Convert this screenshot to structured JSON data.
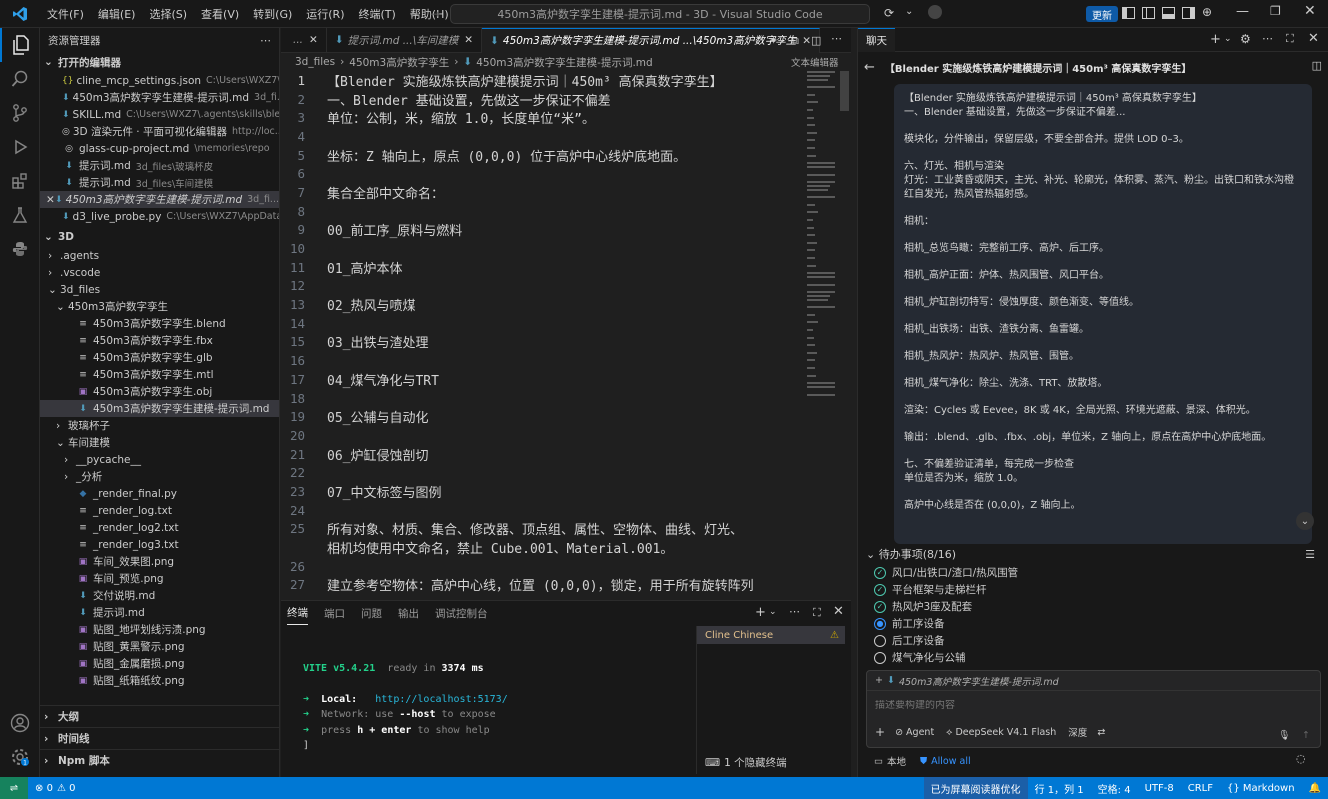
{
  "titlebar": {
    "menus": [
      "文件(F)",
      "编辑(E)",
      "选择(S)",
      "查看(V)",
      "转到(G)",
      "运行(R)",
      "终端(T)",
      "帮助(H)"
    ],
    "command_center": "450m3高炉数字孪生建模-提示词.md - 3D - Visual Studio Code",
    "update_label": "更新"
  },
  "explorer": {
    "title": "资源管理器",
    "open_editors_label": "打开的编辑器",
    "open_editors": [
      {
        "icon": "{}",
        "name": "cline_mcp_settings.json",
        "desc": "C:\\Users\\WXZ7\\.cli..."
      },
      {
        "icon": "⬇",
        "name": "450m3高炉数字孪生建模-提示词.md",
        "desc": "3d_fi..."
      },
      {
        "icon": "⬇",
        "name": "SKILL.md",
        "desc": "C:\\Users\\WXZ7\\.agents\\skills\\blend..."
      },
      {
        "icon": "◎",
        "name": "3D 渲染元件 · 平面可视化编辑器",
        "desc": "http://loc..."
      },
      {
        "icon": "◎",
        "name": "glass-cup-project.md",
        "desc": "\\memories\\repo"
      },
      {
        "icon": "⬇",
        "name": "提示词.md",
        "desc": "3d_files\\玻璃杯皮"
      },
      {
        "icon": "⬇",
        "name": "提示词.md",
        "desc": "3d_files\\车间建模"
      },
      {
        "icon": "⬇",
        "name": "450m3高炉数字孪生建模-提示词.md",
        "desc": "3d_fi..."
      },
      {
        "icon": "⬇",
        "name": "d3_live_probe.py",
        "desc": "C:\\Users\\WXZ7\\AppData\\L..."
      }
    ],
    "folder_label": "3D",
    "tree": [
      {
        "indent": 1,
        "chev": "›",
        "icon": "",
        "name": ".agents"
      },
      {
        "indent": 1,
        "chev": "›",
        "icon": "",
        "name": ".vscode"
      },
      {
        "indent": 1,
        "chev": "⌄",
        "icon": "",
        "name": "3d_files"
      },
      {
        "indent": 2,
        "chev": "⌄",
        "icon": "",
        "name": "450m3高炉数字孪生"
      },
      {
        "indent": 3,
        "chev": "",
        "icon": "≡",
        "name": "450m3高炉数字孪生.blend"
      },
      {
        "indent": 3,
        "chev": "",
        "icon": "≡",
        "name": "450m3高炉数字孪生.fbx"
      },
      {
        "indent": 3,
        "chev": "",
        "icon": "≡",
        "name": "450m3高炉数字孪生.glb"
      },
      {
        "indent": 3,
        "chev": "",
        "icon": "≡",
        "name": "450m3高炉数字孪生.mtl"
      },
      {
        "indent": 3,
        "chev": "",
        "icon": "▣",
        "name": "450m3高炉数字孪生.obj"
      },
      {
        "indent": 3,
        "chev": "",
        "icon": "⬇",
        "name": "450m3高炉数字孪生建模-提示词.md"
      },
      {
        "indent": 2,
        "chev": "›",
        "icon": "",
        "name": "玻璃杯子"
      },
      {
        "indent": 2,
        "chev": "⌄",
        "icon": "",
        "name": "车间建模"
      },
      {
        "indent": 3,
        "chev": "›",
        "icon": "",
        "name": "__pycache__"
      },
      {
        "indent": 3,
        "chev": "›",
        "icon": "",
        "name": "_分析"
      },
      {
        "indent": 3,
        "chev": "",
        "icon": "◆",
        "name": "_render_final.py"
      },
      {
        "indent": 3,
        "chev": "",
        "icon": "≡",
        "name": "_render_log.txt"
      },
      {
        "indent": 3,
        "chev": "",
        "icon": "≡",
        "name": "_render_log2.txt"
      },
      {
        "indent": 3,
        "chev": "",
        "icon": "≡",
        "name": "_render_log3.txt"
      },
      {
        "indent": 3,
        "chev": "",
        "icon": "▣",
        "name": "车间_效果图.png"
      },
      {
        "indent": 3,
        "chev": "",
        "icon": "▣",
        "name": "车间_预览.png"
      },
      {
        "indent": 3,
        "chev": "",
        "icon": "⬇",
        "name": "交付说明.md"
      },
      {
        "indent": 3,
        "chev": "",
        "icon": "⬇",
        "name": "提示词.md"
      },
      {
        "indent": 3,
        "chev": "",
        "icon": "▣",
        "name": "贴图_地坪划线污渍.png"
      },
      {
        "indent": 3,
        "chev": "",
        "icon": "▣",
        "name": "贴图_黄黑警示.png"
      },
      {
        "indent": 3,
        "chev": "",
        "icon": "▣",
        "name": "贴图_金属磨损.png"
      },
      {
        "indent": 3,
        "chev": "",
        "icon": "▣",
        "name": "贴图_纸箱纸纹.png"
      }
    ],
    "bottom_sections": [
      "大纲",
      "时间线",
      "Npm 脚本"
    ]
  },
  "editor": {
    "tabs": [
      {
        "label": "...",
        "close": false
      },
      {
        "label": "提示词.md ...\\车间建模",
        "close": true
      },
      {
        "label": "450m3高炉数字孪生建模-提示词.md ...\\450m3高炉数字孪生",
        "close": true,
        "active": true
      }
    ],
    "breadcrumb": [
      "3d_files",
      "450m3高炉数字孪生",
      "450m3高炉数字孪生建模-提示词.md"
    ],
    "text_editor_label": "文本编辑器",
    "lines": [
      {
        "n": "1",
        "t": "【Blender 实施级炼铁高炉建模提示词｜450m³ 高保真数字孪生】"
      },
      {
        "n": "2",
        "t": "一、Blender 基础设置，先做这一步保证不偏差"
      },
      {
        "n": "3",
        "t": "单位：公制，米，缩放 1.0，长度单位“米”。"
      },
      {
        "n": "4",
        "t": ""
      },
      {
        "n": "5",
        "t": "坐标：Z 轴向上，原点 (0,0,0) 位于高炉中心线炉底地面。"
      },
      {
        "n": "6",
        "t": ""
      },
      {
        "n": "7",
        "t": "集合全部中文命名："
      },
      {
        "n": "8",
        "t": ""
      },
      {
        "n": "9",
        "t": "00_前工序_原料与燃料"
      },
      {
        "n": "10",
        "t": ""
      },
      {
        "n": "11",
        "t": "01_高炉本体"
      },
      {
        "n": "12",
        "t": ""
      },
      {
        "n": "13",
        "t": "02_热风与喷煤"
      },
      {
        "n": "14",
        "t": ""
      },
      {
        "n": "15",
        "t": "03_出铁与渣处理"
      },
      {
        "n": "16",
        "t": ""
      },
      {
        "n": "17",
        "t": "04_煤气净化与TRT"
      },
      {
        "n": "18",
        "t": ""
      },
      {
        "n": "19",
        "t": "05_公辅与自动化"
      },
      {
        "n": "20",
        "t": ""
      },
      {
        "n": "21",
        "t": "06_炉缸侵蚀剖切"
      },
      {
        "n": "22",
        "t": ""
      },
      {
        "n": "23",
        "t": "07_中文标签与图例"
      },
      {
        "n": "24",
        "t": ""
      },
      {
        "n": "25",
        "t": "所有对象、材质、集合、修改器、顶点组、属性、空物体、曲线、灯光、"
      },
      {
        "n": "",
        "t": "相机均使用中文命名，禁止 Cube.001、Material.001。"
      },
      {
        "n": "26",
        "t": ""
      },
      {
        "n": "27",
        "t": "建立参考空物体：高炉中心线，位置 (0,0,0)，锁定，用于所有旋转阵列"
      }
    ]
  },
  "panel": {
    "tabs": [
      "终端",
      "端口",
      "问题",
      "输出",
      "调试控制台"
    ],
    "terminal": {
      "vite": "VITE v5.4.21",
      "ready": "ready in",
      "ms": "3374 ms",
      "local_label": "Local:",
      "local_url": "http://localhost:5173/",
      "network": "Network: use",
      "host_flag": "--host",
      "network_tail": "to expose",
      "press": "press",
      "keys": "h + enter",
      "help_tail": "to show help"
    },
    "side_item": "Cline Chinese",
    "hidden_terminals": "1 个隐藏终端"
  },
  "chat": {
    "header_label": "聊天",
    "title": "【Blender 实施级炼铁高炉建模提示词｜450m³ 高保真数字孪生】",
    "message": [
      "【Blender 实施级炼铁高炉建模提示词｜450m³ 高保真数字孪生】",
      "一、Blender 基础设置，先做这一步保证不偏差...",
      "",
      "模块化，分件输出，保留层级，不要全部合并。提供 LOD 0–3。",
      "",
      "六、灯光、相机与渲染",
      "灯光：工业黄昏或阴天，主光、补光、轮廓光，体积雾、蒸汽、粉尘。出铁口和铁水沟橙",
      "红自发光，热风管热辐射感。",
      "",
      "相机：",
      "",
      "相机_总览鸟瞰：完整前工序、高炉、后工序。",
      "",
      "相机_高炉正面：炉体、热风围管、风口平台。",
      "",
      "相机_炉缸剖切特写：侵蚀厚度、颜色渐变、等值线。",
      "",
      "相机_出铁场：出铁、渣铁分离、鱼雷罐。",
      "",
      "相机_热风炉：热风炉、热风管、围管。",
      "",
      "相机_煤气净化：除尘、洗涤、TRT、放散塔。",
      "",
      "渲染：Cycles 或 Eevee，8K 或 4K，全局光照、环境光遮蔽、景深、体积光。",
      "",
      "输出：.blend、.glb、.fbx、.obj，单位米，Z 轴向上，原点在高炉中心炉底地面。",
      "",
      "七、不偏差验证清单，每完成一步检查",
      "单位是否为米，缩放 1.0。",
      "",
      "高炉中心线是否在 (0,0,0)，Z 轴向上。"
    ],
    "todo_label": "待办事项(8/16)",
    "todos": [
      {
        "state": "done",
        "label": "风口/出铁口/渣口/热风围管"
      },
      {
        "state": "done",
        "label": "平台框架与走梯栏杆"
      },
      {
        "state": "done",
        "label": "热风炉3座及配套"
      },
      {
        "state": "active",
        "label": "前工序设备"
      },
      {
        "state": "pending",
        "label": "后工序设备"
      },
      {
        "state": "pending",
        "label": "煤气净化与公辅"
      }
    ],
    "attached_file": "450m3高炉数字孪生建模-提示词.md",
    "input_placeholder": "描述要构建的内容",
    "agent_label": "Agent",
    "model_label": "DeepSeek V4.1 Flash",
    "depth_label": "深度",
    "local_label": "本地",
    "allow_all_label": "Allow all"
  },
  "statusbar": {
    "problems": "0",
    "warnings": "0",
    "screen_reader": "已为屏幕阅读器优化",
    "position": "行 1，列 1",
    "spaces": "空格: 4",
    "encoding": "UTF-8",
    "eol": "CRLF",
    "language": "Markdown"
  },
  "colors": {
    "accent": "#0078d4",
    "status_bar": "#0078d4",
    "todo_done": "#4ec9b0"
  }
}
